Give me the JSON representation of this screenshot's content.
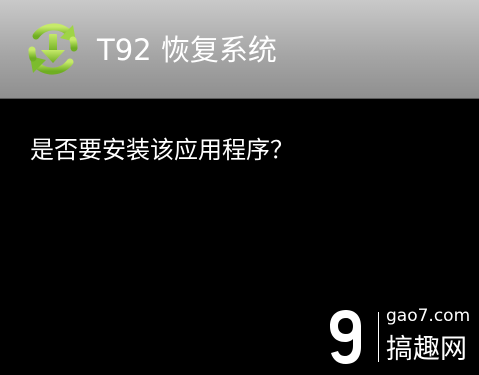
{
  "window": {
    "title": "T92 恢复系统",
    "icon": "recovery-refresh-download-icon"
  },
  "dialog": {
    "prompt": "是否要安装该应用程序？"
  },
  "watermark": {
    "domain": "gao7.com",
    "brand": "搞趣网",
    "logo": "gao7-logo"
  },
  "colors": {
    "title_bar_top": "#c9c9c9",
    "title_bar_bottom": "#8f8f8f",
    "icon_green": "#8cc63f",
    "background": "#000000",
    "text": "#ffffff"
  }
}
